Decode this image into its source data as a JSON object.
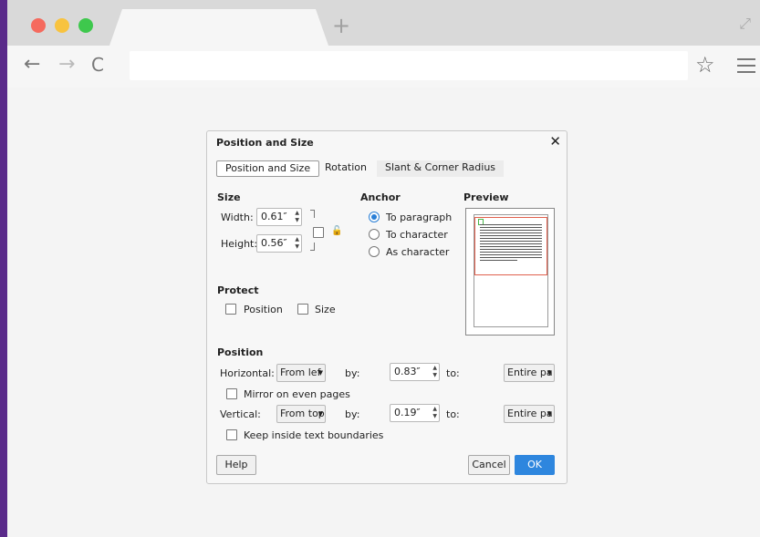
{
  "browser": {
    "new_tab_label": "+",
    "back_icon": "arrow-left-icon",
    "forward_icon": "arrow-right-icon",
    "reload_icon": "reload-icon",
    "bookmark_icon": "star-icon",
    "menu_icon": "hamburger-icon",
    "expand_icon": "expand-icon",
    "url": ""
  },
  "dialog": {
    "title": "Position and Size",
    "close_label": "✕",
    "tabs": [
      {
        "label": "Position and Size",
        "active": true
      },
      {
        "label": "Rotation",
        "active": false
      },
      {
        "label": "Slant & Corner Radius",
        "active": false
      }
    ],
    "size": {
      "heading": "Size",
      "width_label": "Width:",
      "width_value": "0.61″",
      "height_label": "Height:",
      "height_value": "0.56″",
      "keep_ratio_checked": false
    },
    "anchor": {
      "heading": "Anchor",
      "options": [
        {
          "label": "To paragraph",
          "selected": true
        },
        {
          "label": "To character",
          "selected": false
        },
        {
          "label": "As character",
          "selected": false
        }
      ]
    },
    "preview": {
      "heading": "Preview"
    },
    "protect": {
      "heading": "Protect",
      "position_label": "Position",
      "position_checked": false,
      "size_label": "Size",
      "size_checked": false
    },
    "position": {
      "heading": "Position",
      "horizontal_label": "Horizontal:",
      "horizontal_combo": "From lef",
      "h_by_label": "by:",
      "h_by_value": "0.83″",
      "h_to_label": "to:",
      "h_to_combo": "Entire pa",
      "mirror_label": "Mirror on even pages",
      "mirror_checked": false,
      "vertical_label": "Vertical:",
      "vertical_combo": "From top",
      "v_by_label": "by:",
      "v_by_value": "0.19″",
      "v_to_label": "to:",
      "v_to_combo": "Entire pa",
      "keep_inside_label": "Keep inside text boundaries",
      "keep_inside_checked": false
    },
    "buttons": {
      "help": "Help",
      "cancel": "Cancel",
      "ok": "OK"
    }
  },
  "colors": {
    "background": "#5a2a8a",
    "accent": "#2e86de",
    "preview_frame": "#e0604d",
    "preview_object": "#49b649"
  }
}
